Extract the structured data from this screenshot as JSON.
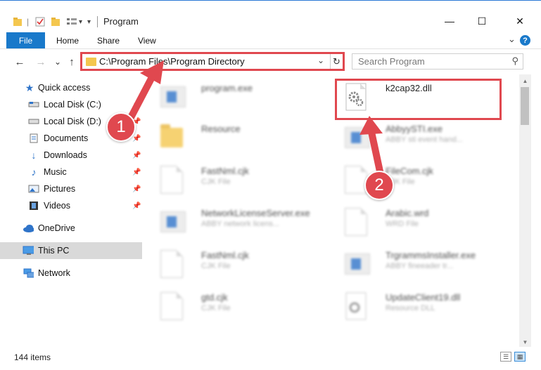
{
  "window": {
    "title": "Program",
    "minimize": "—",
    "maximize": "☐",
    "close": "✕"
  },
  "ribbon": {
    "file": "File",
    "tabs": [
      "Home",
      "Share",
      "View"
    ],
    "expand": "⌄",
    "help": "?"
  },
  "nav": {
    "back": "←",
    "forward": "→",
    "recent": "⌄",
    "up": "↑",
    "address": "C:\\Program Files\\Program Directory",
    "address_chevron": "⌄",
    "refresh": "↻",
    "search_placeholder": "Search Program",
    "search_icon": "⚲"
  },
  "sidebar": {
    "items": [
      {
        "label": "Quick access",
        "icon": "star-icon"
      },
      {
        "label": "Local Disk (C:)",
        "icon": "drive-icon"
      },
      {
        "label": "Local Disk (D:)",
        "icon": "drive-icon"
      },
      {
        "label": "Documents",
        "icon": "documents-icon"
      },
      {
        "label": "Downloads",
        "icon": "downloads-icon"
      },
      {
        "label": "Music",
        "icon": "music-icon"
      },
      {
        "label": "Pictures",
        "icon": "pictures-icon"
      },
      {
        "label": "Videos",
        "icon": "videos-icon"
      },
      {
        "label": "OneDrive",
        "icon": "cloud-icon"
      },
      {
        "label": "This PC",
        "icon": "computer-icon"
      },
      {
        "label": "Network",
        "icon": "network-icon"
      }
    ]
  },
  "files": [
    {
      "name": "program.exe",
      "desc": "",
      "type": "exe"
    },
    {
      "name": "k2cap32.dll",
      "desc": "",
      "type": "dll"
    },
    {
      "name": "Resource",
      "desc": "",
      "type": "folder"
    },
    {
      "name": "AbbyySTI.exe",
      "desc": "ABBY sti event hand...",
      "type": "exe"
    },
    {
      "name": "FastNml.cjk",
      "desc": "CJK File",
      "type": "doc"
    },
    {
      "name": "FileCom.cjk",
      "desc": "CJK File",
      "type": "doc"
    },
    {
      "name": "NetworkLicenseServer.exe",
      "desc": "ABBY network licens...",
      "type": "exe"
    },
    {
      "name": "Arabic.wrd",
      "desc": "WRD File",
      "type": "doc"
    },
    {
      "name": "FastNml.cjk",
      "desc": "CJK File",
      "type": "doc"
    },
    {
      "name": "TrgrammsInstaller.exe",
      "desc": "ABBY fineeader tr...",
      "type": "exe"
    },
    {
      "name": "gtd.cjk",
      "desc": "CJK File",
      "type": "doc"
    },
    {
      "name": "UpdateClient19.dll",
      "desc": "Resource DLL",
      "type": "dll"
    }
  ],
  "status": {
    "count": "144 items"
  },
  "callouts": {
    "one": "1",
    "two": "2"
  },
  "colors": {
    "accent": "#1979ca",
    "highlight": "#e0484f",
    "folder": "#f4c74f"
  }
}
